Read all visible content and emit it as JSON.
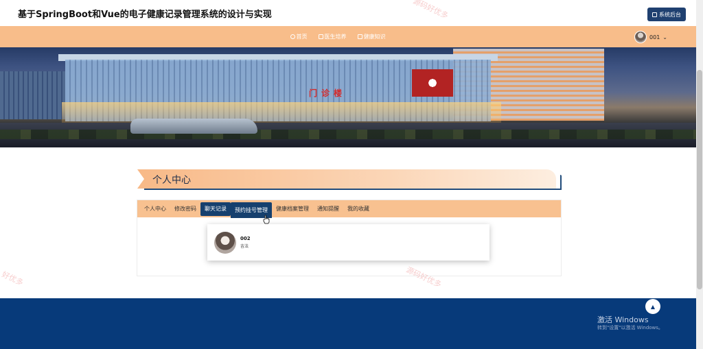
{
  "header": {
    "site_title": "基于SpringBoot和Vue的电子健康记录管理系统的设计与实现",
    "admin_button": "系统后台"
  },
  "nav": {
    "items": [
      {
        "label": "首页",
        "icon": "home-icon"
      },
      {
        "label": "医生培养",
        "icon": "doctor-icon"
      },
      {
        "label": "健康知识",
        "icon": "book-icon"
      }
    ],
    "user_name": "001",
    "user_caret": "⌄"
  },
  "banner": {
    "sign_text": "门诊楼"
  },
  "section": {
    "title": "个人中心"
  },
  "tabs": [
    {
      "label": "个人中心",
      "state": "normal"
    },
    {
      "label": "修改密码",
      "state": "normal"
    },
    {
      "label": "聊天记录",
      "state": "active"
    },
    {
      "label": "预约挂号管理",
      "state": "hover"
    },
    {
      "label": "健康档案管理",
      "state": "normal"
    },
    {
      "label": "通知提醒",
      "state": "normal"
    },
    {
      "label": "我的收藏",
      "state": "normal"
    }
  ],
  "chat": {
    "name": "002",
    "last_message": "吉法"
  },
  "footer": {
    "back_to_top": "▲",
    "windows_activate": "激活 Windows",
    "windows_sub": "转到\"设置\"以激活 Windows。"
  },
  "watermarks": [
    "源码好优多",
    "好优多",
    "源码好优多"
  ],
  "colors": {
    "nav_bg": "#f8bd8a",
    "primary_dark": "#16406e",
    "footer_bg": "#073a7a"
  }
}
